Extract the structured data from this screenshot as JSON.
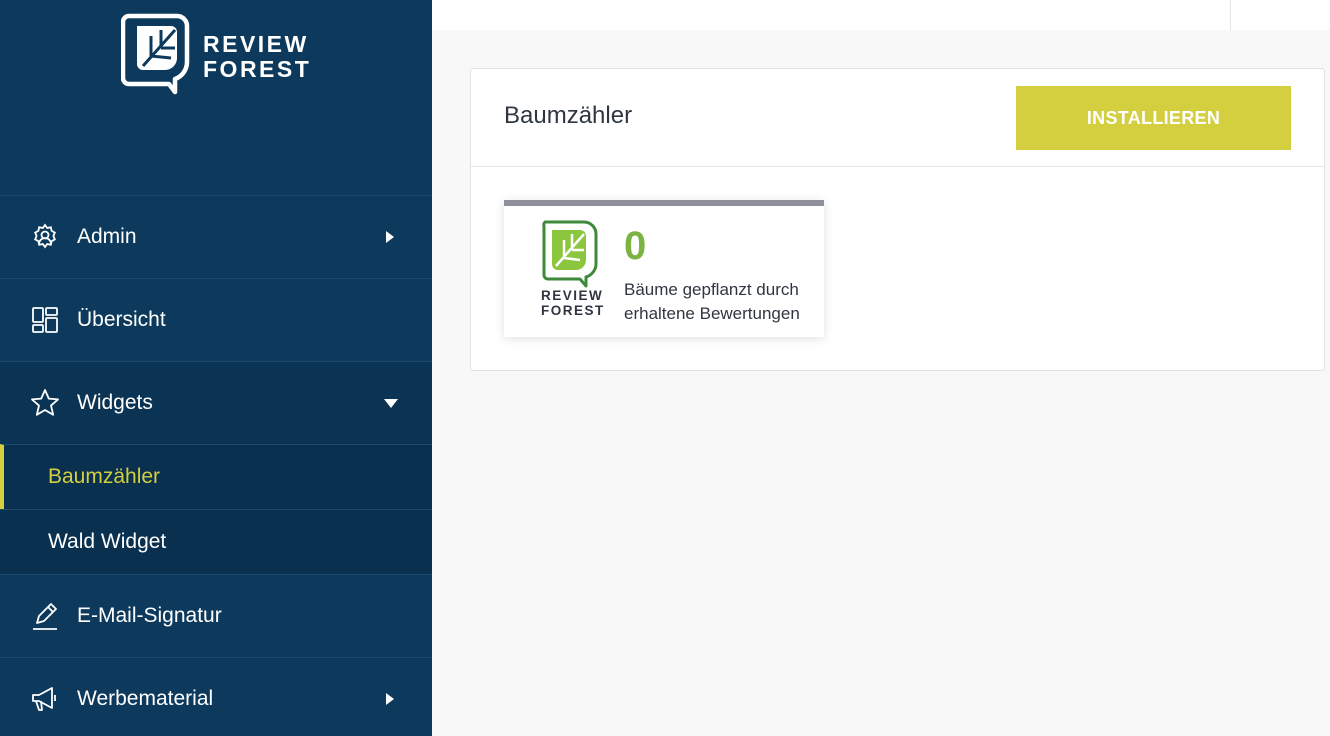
{
  "brand": {
    "line1": "REVIEW",
    "line2": "FOREST"
  },
  "sidebar": {
    "items": [
      {
        "label": "Admin",
        "icon": "gear-user-icon"
      },
      {
        "label": "Übersicht",
        "icon": "dashboard-icon"
      },
      {
        "label": "Widgets",
        "icon": "star-icon"
      },
      {
        "label": "E-Mail-Signatur",
        "icon": "pen-icon"
      },
      {
        "label": "Werbematerial",
        "icon": "megaphone-icon"
      }
    ],
    "widgets_subitems": [
      {
        "label": "Baumzähler"
      },
      {
        "label": "Wald Widget"
      }
    ]
  },
  "main": {
    "title": "Baumzähler",
    "install_label": "INSTALLIEREN",
    "widget": {
      "count": "0",
      "line1": "Bäume gepflanzt durch",
      "line2": "erhaltene Bewertungen",
      "brand_line1": "REVIEW",
      "brand_line2": "FOREST"
    }
  },
  "colors": {
    "sidebar_bg": "#0d3a5c",
    "accent": "#d3cf3e",
    "count_green": "#7cb342"
  }
}
